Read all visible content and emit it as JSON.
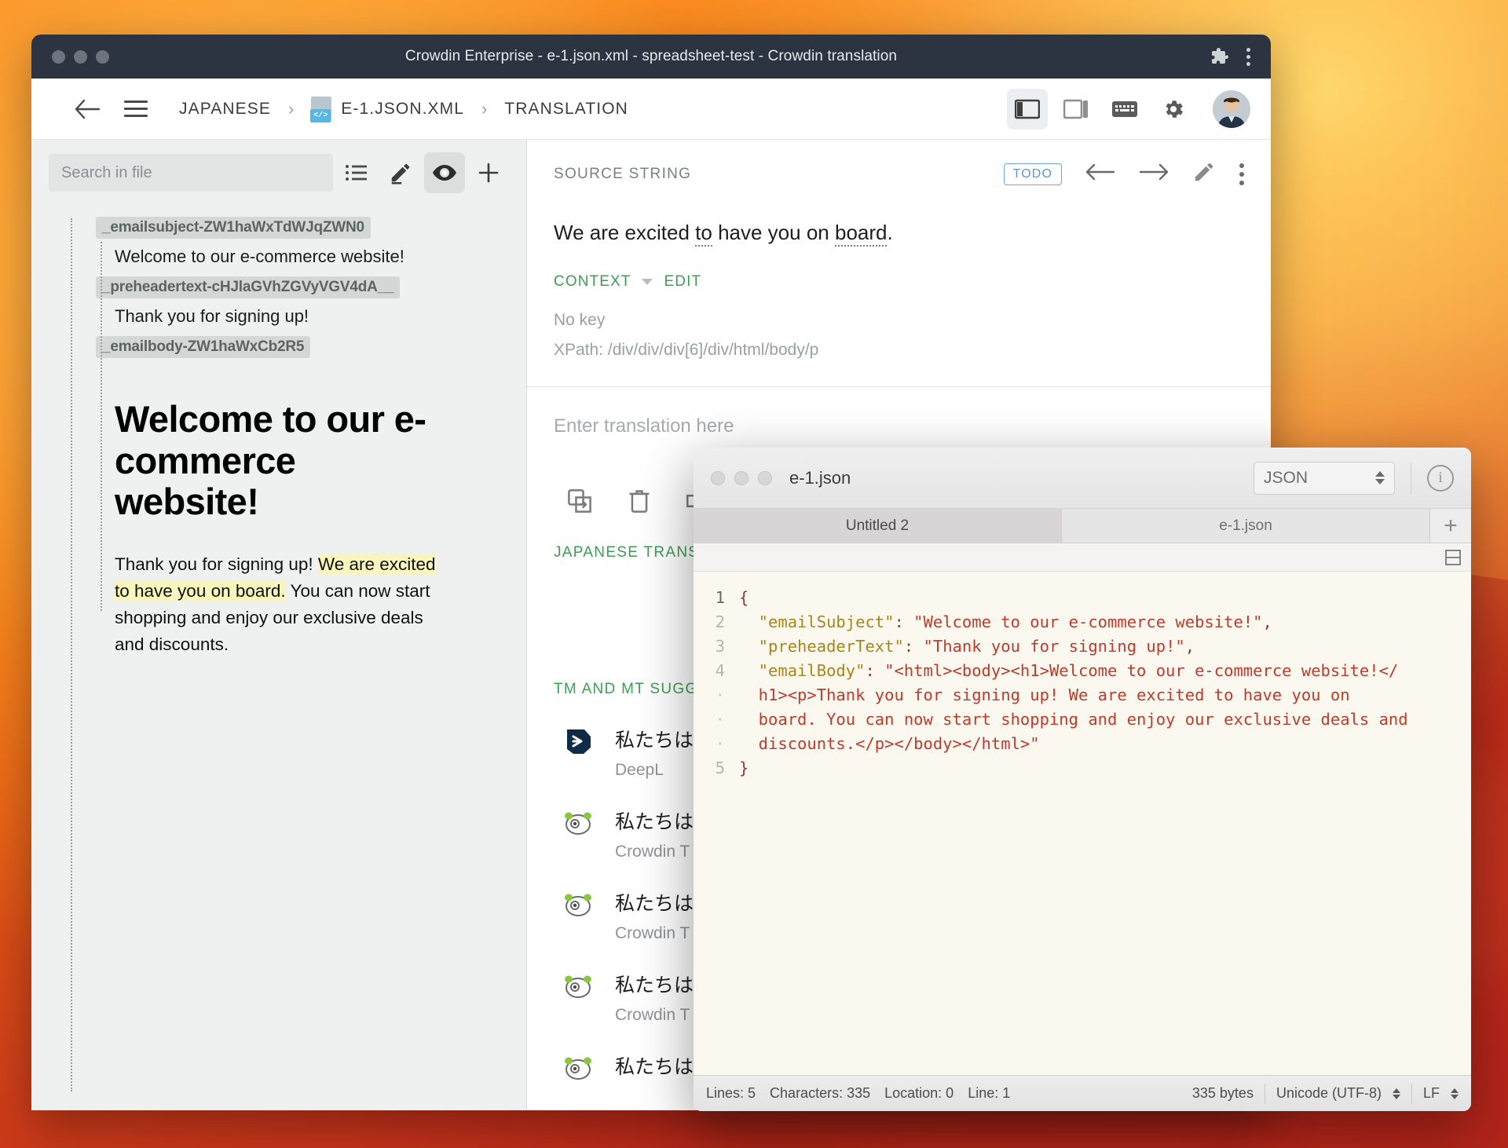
{
  "window": {
    "title": "Crowdin Enterprise - e-1.json.xml - spreadsheet-test - Crowdin translation"
  },
  "header": {
    "breadcrumb": [
      {
        "label": "JAPANESE",
        "name": "breadcrumb-language"
      },
      {
        "label": "E-1.JSON.XML",
        "name": "breadcrumb-file"
      },
      {
        "label": "TRANSLATION",
        "name": "breadcrumb-section"
      }
    ],
    "separator": "›",
    "file_tag": "</>",
    "icons": [
      "back-arrow-icon",
      "menu-icon",
      "layout-split-icon",
      "layout-single-icon",
      "keyboard-icon",
      "gear-icon",
      "avatar"
    ]
  },
  "sidebar": {
    "search": {
      "placeholder": "Search in file",
      "value": ""
    },
    "buttons": [
      "list-view-icon",
      "edit-icon",
      "preview-icon",
      "add-icon"
    ],
    "segments": [
      {
        "key": "_emailsubject-ZW1haWxTdWJqZWN0",
        "text": "Welcome to our e-commerce website!"
      },
      {
        "key": "_preheadertext-cHJlaGVhZGVyVGV4dA__",
        "text": "Thank you for signing up!"
      },
      {
        "key": "_emailbody-ZW1haWxCb2R5",
        "text": ""
      }
    ],
    "preview": {
      "heading": "Welcome to our e-commerce website!",
      "paragraph_before": "Thank you for signing up! ",
      "paragraph_highlight": "We are excited to have you on board.",
      "paragraph_after": " You can now start shopping and enjoy our exclusive deals and discounts."
    }
  },
  "editor": {
    "source_label": "SOURCE STRING",
    "status_badge": "TODO",
    "source_text_parts": [
      {
        "t": "We are excited ",
        "u": false
      },
      {
        "t": "to",
        "u": true
      },
      {
        "t": " have you on ",
        "u": false
      },
      {
        "t": "board",
        "u": true
      },
      {
        "t": ".",
        "u": false
      }
    ],
    "context_label": "CONTEXT",
    "edit_label": "EDIT",
    "context_key": "No key",
    "context_xpath": "XPath: /div/div/div[6]/div/html/body/p",
    "translation_placeholder": "Enter translation here",
    "toolbar_icons": [
      "copy-source-icon",
      "delete-icon",
      "compare-icon"
    ],
    "japanese_translations_label": "JAPANESE TRANS",
    "tm_label": "TM AND MT SUGG",
    "suggestions": [
      {
        "text": "私たちは.",
        "source": "DeepL",
        "icon": "deepl-icon"
      },
      {
        "text": "私たちは",
        "source": "Crowdin T",
        "icon": "crowdin-icon"
      },
      {
        "text": "私たちは",
        "source": "Crowdin T",
        "icon": "crowdin-icon"
      },
      {
        "text": "私たちは",
        "source": "Crowdin T",
        "icon": "crowdin-icon"
      },
      {
        "text": "私たちは",
        "source": "",
        "icon": "crowdin-icon"
      }
    ]
  },
  "json_editor": {
    "filename": "e-1.json",
    "language": "JSON",
    "tabs": [
      {
        "label": "Untitled 2",
        "active": true
      },
      {
        "label": "e-1.json",
        "active": false
      }
    ],
    "new_tab_label": "+",
    "lines": [
      {
        "num": "1",
        "segments": [
          {
            "t": "{",
            "c": "pun"
          }
        ]
      },
      {
        "num": "2",
        "segments": [
          {
            "t": "  \"emailSubject\"",
            "c": "k"
          },
          {
            "t": ": ",
            "c": "pun"
          },
          {
            "t": "\"Welcome to our e-commerce website!\"",
            "c": "code"
          },
          {
            "t": ",",
            "c": "pun"
          }
        ]
      },
      {
        "num": "3",
        "segments": [
          {
            "t": "  \"preheaderText\"",
            "c": "k"
          },
          {
            "t": ": ",
            "c": "pun"
          },
          {
            "t": "\"Thank you for signing up!\"",
            "c": "code"
          },
          {
            "t": ",",
            "c": "pun"
          }
        ]
      },
      {
        "num": "4",
        "segments": [
          {
            "t": "  \"emailBody\"",
            "c": "k"
          },
          {
            "t": ": ",
            "c": "pun"
          },
          {
            "t": "\"<html><body><h1>Welcome to our e-commerce website!</",
            "c": "code"
          }
        ]
      },
      {
        "num": "·",
        "segments": [
          {
            "t": "  h1><p>Thank you for signing up! We are excited to have you on",
            "c": "code"
          }
        ]
      },
      {
        "num": "·",
        "segments": [
          {
            "t": "  board. You can now start shopping and enjoy our exclusive deals and",
            "c": "code"
          }
        ]
      },
      {
        "num": "·",
        "segments": [
          {
            "t": "  discounts.</p></body></html>\"",
            "c": "code"
          }
        ]
      },
      {
        "num": "5",
        "segments": [
          {
            "t": "}",
            "c": "pun"
          }
        ]
      }
    ],
    "status": {
      "lines": "Lines: 5",
      "characters": "Characters: 335",
      "location": "Location: 0",
      "line": "Line: 1",
      "bytes": "335 bytes",
      "encoding": "Unicode (UTF-8)",
      "line_ending": "LF"
    }
  },
  "colors": {
    "accent_green": "#3f9c54",
    "badge_blue": "#5b95e0",
    "titlebar": "#2b3440",
    "highlight": "#f8f5bd"
  }
}
